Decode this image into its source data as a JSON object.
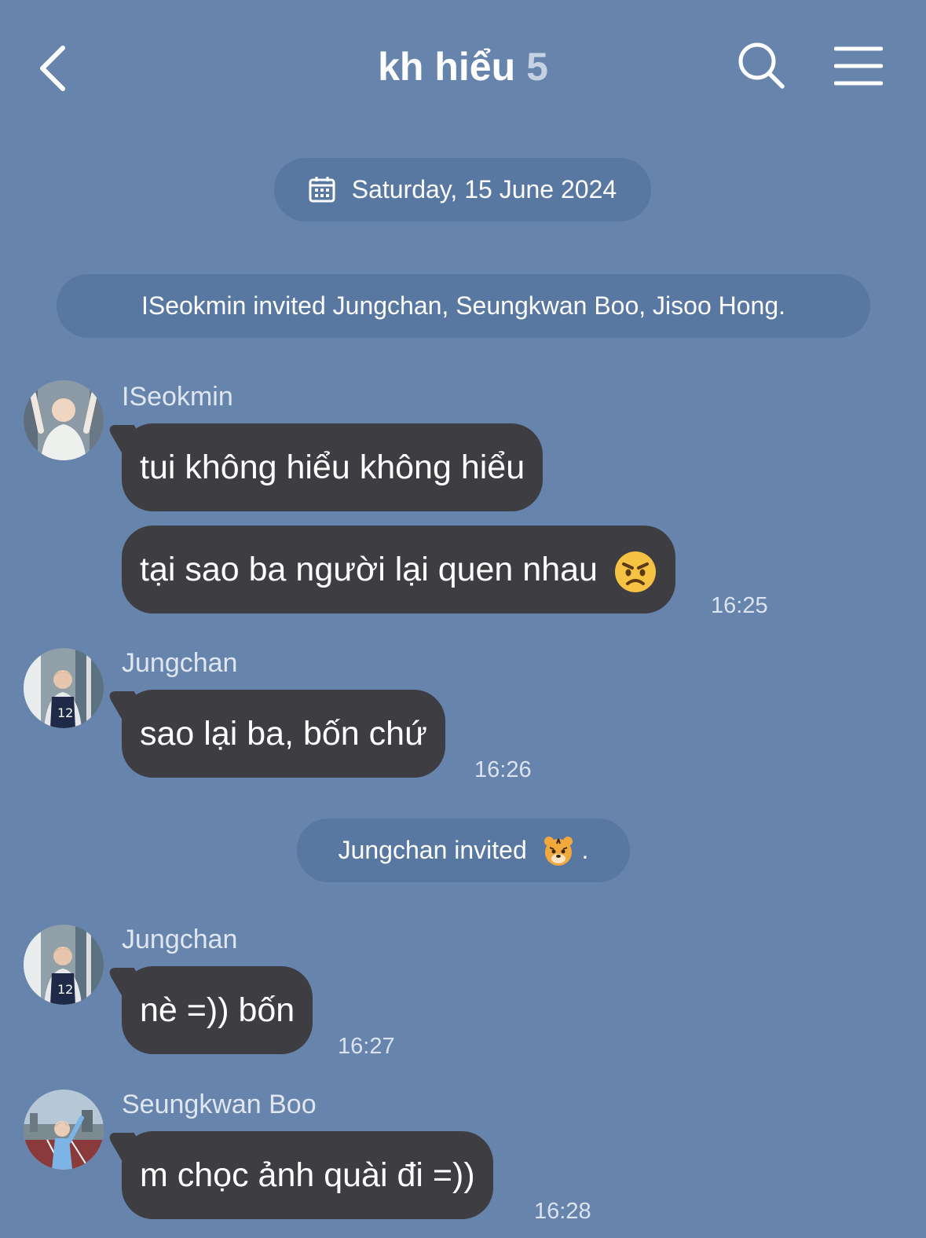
{
  "header": {
    "back_icon": "chevron-left-icon",
    "title": "kh hiểu",
    "member_count": "5",
    "search_icon": "search-icon",
    "menu_icon": "hamburger-menu-icon"
  },
  "date_separator": {
    "icon": "calendar-icon",
    "text": "Saturday, 15 June 2024"
  },
  "system_messages": [
    {
      "text": "ISeokmin invited Jungchan, Seungkwan Boo, Jisoo Hong."
    },
    {
      "text": "Jungchan invited",
      "emoji": "tiger-face-emoji",
      "suffix": "."
    }
  ],
  "messages": [
    {
      "sender": "ISeokmin",
      "text": "tui không hiểu không hiểu"
    },
    {
      "text": "tại sao ba người lại quen nhau",
      "emoji": "angry-face-emoji",
      "time": "16:25"
    },
    {
      "sender": "Jungchan",
      "text": "sao lại ba, bốn chứ",
      "time": "16:26"
    },
    {
      "sender": "Jungchan",
      "text": "nè =)) bốn",
      "time": "16:27"
    },
    {
      "sender": "Seungkwan Boo",
      "text": "m chọc ảnh quài đi =))",
      "time": "16:28"
    }
  ],
  "colors": {
    "background": "#6784ad",
    "bubble": "#3d3d42",
    "pill": "#5877a1"
  }
}
